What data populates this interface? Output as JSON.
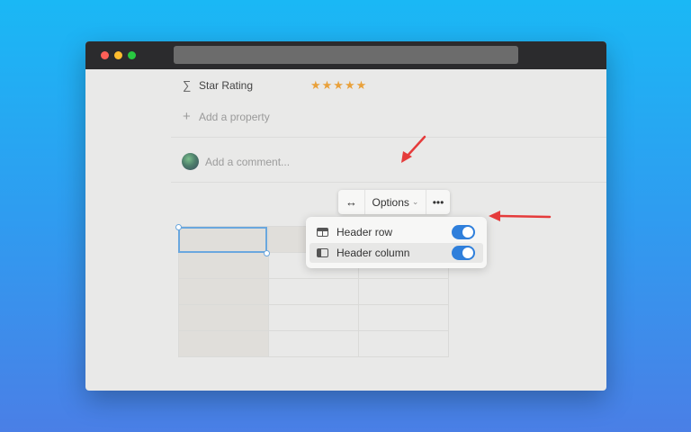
{
  "window": {
    "traffic_lights": [
      "close",
      "minimize",
      "maximize"
    ],
    "url": ""
  },
  "properties": {
    "star_rating": {
      "icon": "sigma-icon",
      "label": "Star Rating",
      "value": "★★★★★",
      "rating": 5,
      "max": 5
    },
    "add_property": "Add a property"
  },
  "comment": {
    "placeholder": "Add a comment..."
  },
  "toolbar": {
    "resize_label": "↔",
    "options_label": "Options",
    "more_label": "•••"
  },
  "menu": {
    "items": [
      {
        "label": "Header row",
        "enabled": true
      },
      {
        "label": "Header column",
        "enabled": true
      }
    ]
  },
  "colors": {
    "accent": "#2f7fdb",
    "star": "#e9a13b",
    "annotation_arrow": "#e53b3b"
  }
}
